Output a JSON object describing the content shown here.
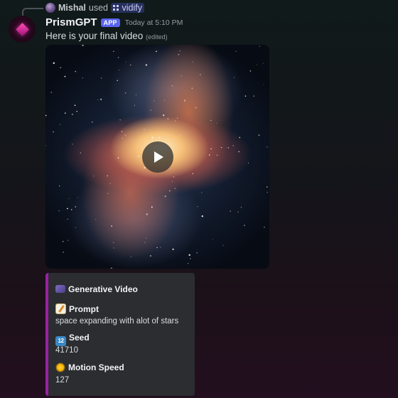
{
  "reply": {
    "user": "Mishal",
    "used_text": "used",
    "command": "vidify",
    "command_icon": "slash-command-icon"
  },
  "message": {
    "author": "PrismGPT",
    "badge": "APP",
    "timestamp": "Today at 5:10 PM",
    "content": "Here is your final video",
    "edited": "(edited)"
  },
  "video": {
    "play_icon": "play-icon"
  },
  "embed": {
    "accent_color": "#9b1fa6",
    "title": "Generative Video",
    "title_icon": "movie-camera-icon",
    "fields": [
      {
        "name": "Prompt",
        "icon": "memo-icon",
        "value": "space expanding with alot of stars"
      },
      {
        "name": "Seed",
        "icon": "input-numbers-icon",
        "value": "41710"
      },
      {
        "name": "Motion Speed",
        "icon": "sun-icon",
        "value": "127"
      }
    ]
  },
  "colors": {
    "app_badge": "#5865f2",
    "username": "#f2f3f5",
    "timestamp": "#949ba4",
    "embed_bg": "#2b2d31"
  }
}
